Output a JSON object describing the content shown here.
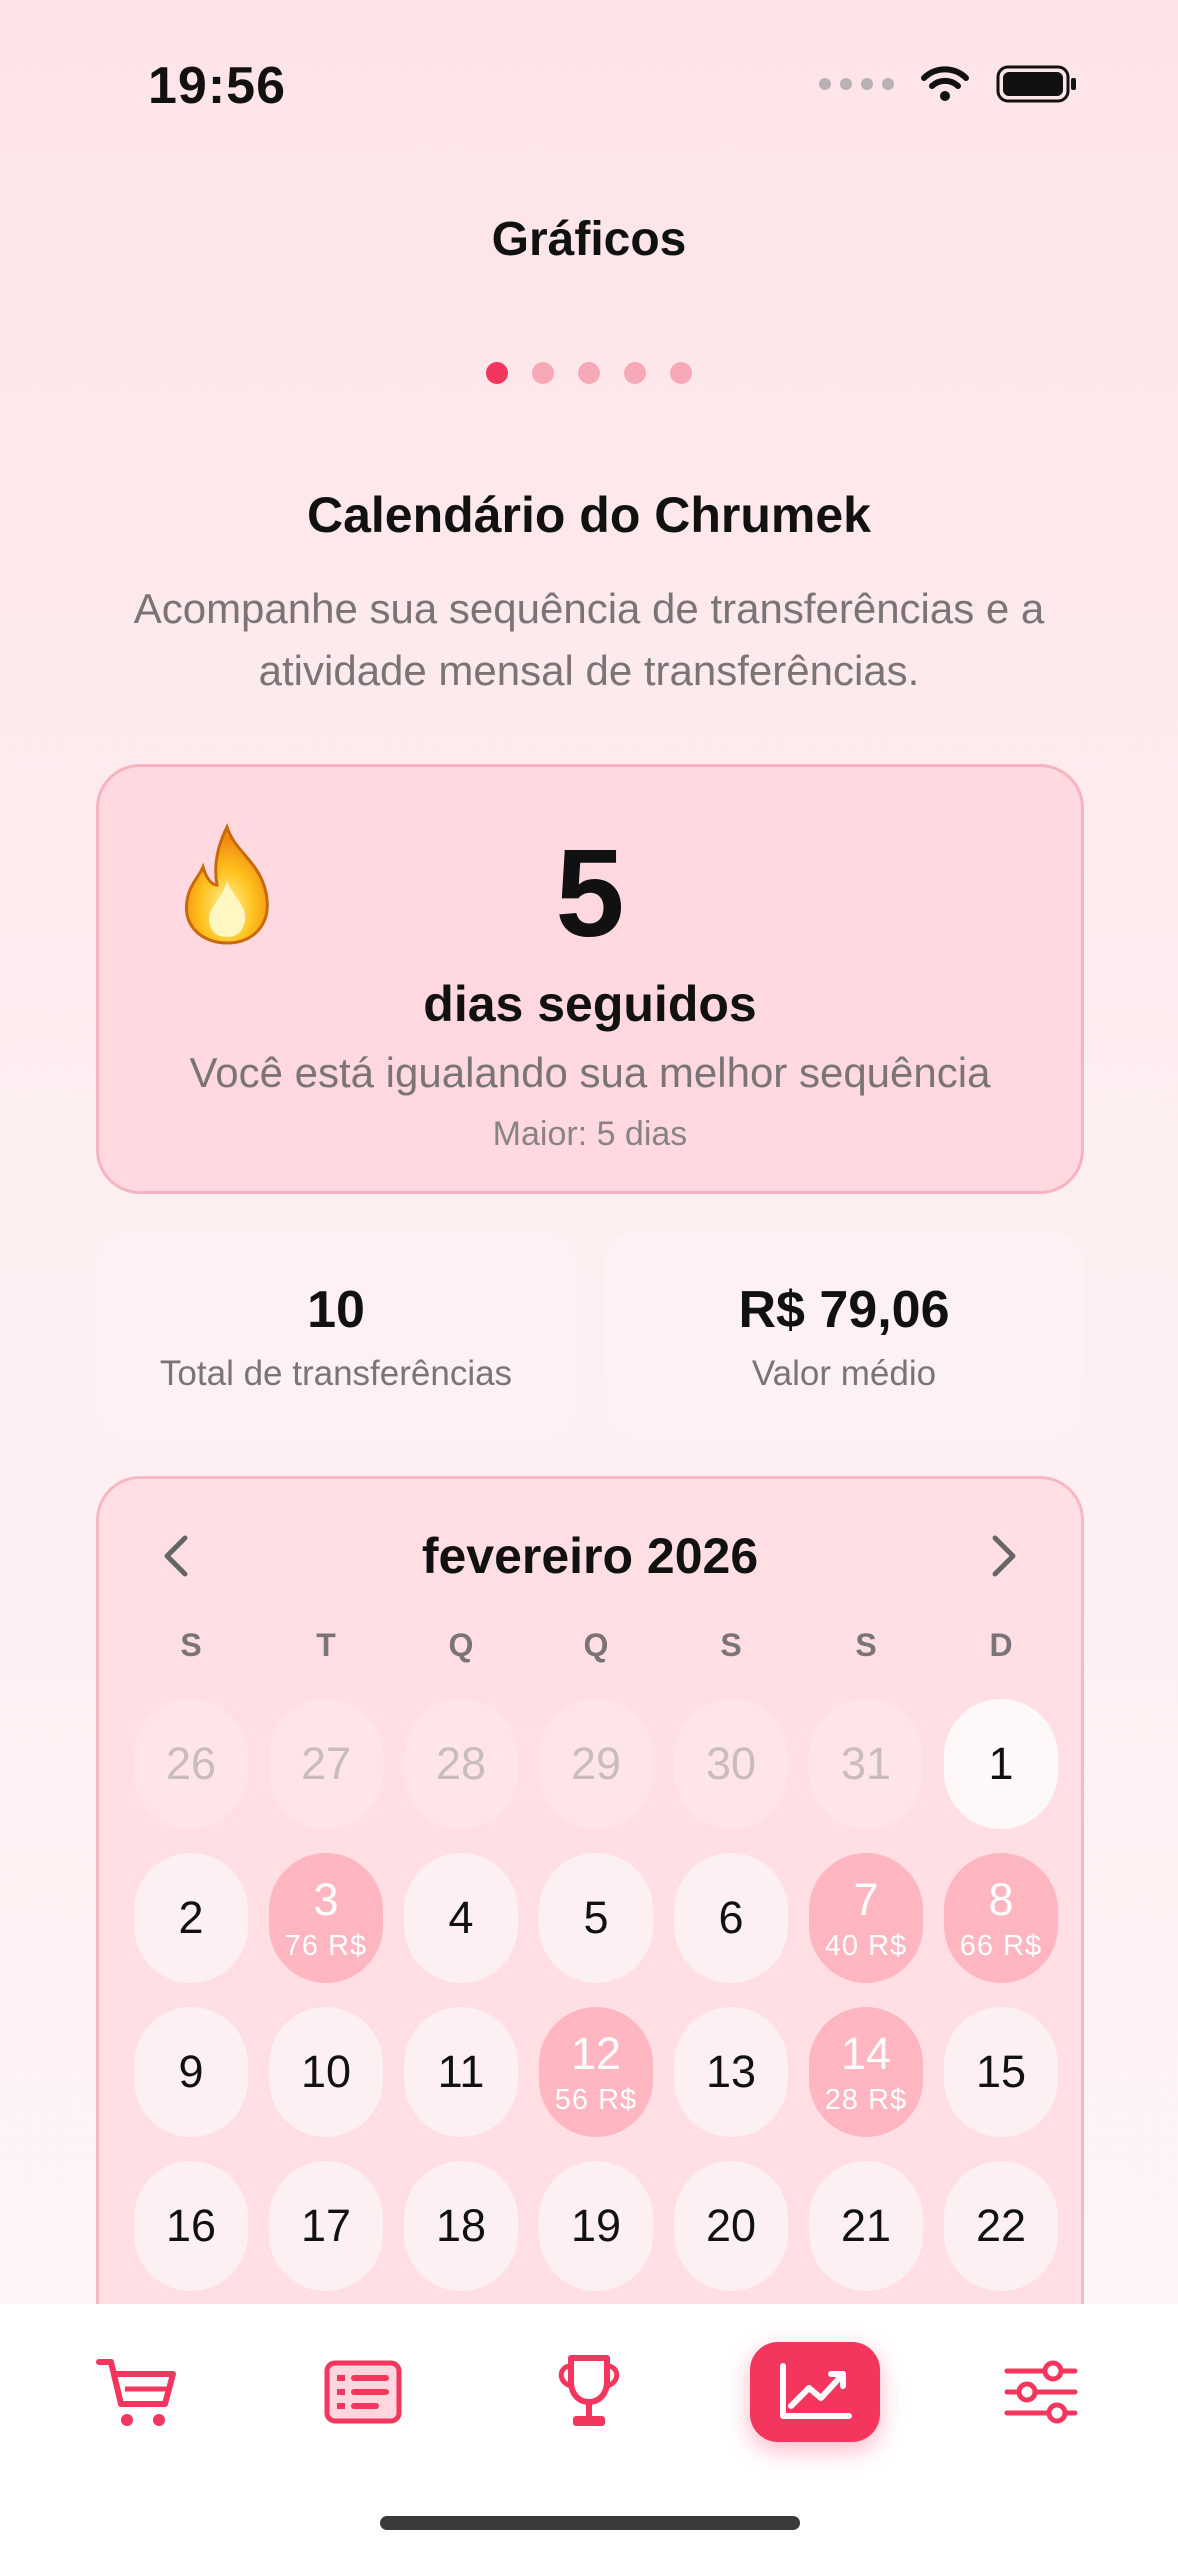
{
  "status_bar": {
    "time": "19:56"
  },
  "header": {
    "title": "Gráficos",
    "pager": {
      "count": 5,
      "active_index": 0
    }
  },
  "section": {
    "title": "Calendário do Chrumek",
    "subtitle": "Acompanhe sua sequência de transferências e a atividade mensal de transferências."
  },
  "streak": {
    "icon": "flame-icon",
    "value": "5",
    "label": "dias seguidos",
    "message": "Você está igualando sua melhor sequência",
    "best": "Maior: 5 dias"
  },
  "stats": {
    "total": {
      "value": "10",
      "label": "Total de transferências"
    },
    "average": {
      "value": "R$ 79,06",
      "label": "Valor médio"
    }
  },
  "calendar": {
    "month_label": "fevereiro 2026",
    "weekdays": [
      "S",
      "T",
      "Q",
      "Q",
      "S",
      "S",
      "D"
    ],
    "days": [
      {
        "day": "26",
        "state": "muted"
      },
      {
        "day": "27",
        "state": "muted"
      },
      {
        "day": "28",
        "state": "muted"
      },
      {
        "day": "29",
        "state": "muted"
      },
      {
        "day": "30",
        "state": "muted"
      },
      {
        "day": "31",
        "state": "muted"
      },
      {
        "day": "1",
        "state": "today"
      },
      {
        "day": "2",
        "state": "normal"
      },
      {
        "day": "3",
        "state": "hit",
        "amount": "76 R$"
      },
      {
        "day": "4",
        "state": "normal"
      },
      {
        "day": "5",
        "state": "normal"
      },
      {
        "day": "6",
        "state": "normal"
      },
      {
        "day": "7",
        "state": "hit",
        "amount": "40 R$"
      },
      {
        "day": "8",
        "state": "hit",
        "amount": "66 R$"
      },
      {
        "day": "9",
        "state": "normal"
      },
      {
        "day": "10",
        "state": "normal"
      },
      {
        "day": "11",
        "state": "normal"
      },
      {
        "day": "12",
        "state": "hit",
        "amount": "56 R$"
      },
      {
        "day": "13",
        "state": "normal"
      },
      {
        "day": "14",
        "state": "hit",
        "amount": "28 R$"
      },
      {
        "day": "15",
        "state": "normal"
      },
      {
        "day": "16",
        "state": "normal"
      },
      {
        "day": "17",
        "state": "normal"
      },
      {
        "day": "18",
        "state": "normal"
      },
      {
        "day": "19",
        "state": "normal"
      },
      {
        "day": "20",
        "state": "normal"
      },
      {
        "day": "21",
        "state": "normal"
      },
      {
        "day": "22",
        "state": "normal"
      }
    ]
  },
  "tab_bar": {
    "tabs": [
      {
        "icon": "cart-icon",
        "active": false
      },
      {
        "icon": "list-icon",
        "active": false
      },
      {
        "icon": "trophy-icon",
        "active": false
      },
      {
        "icon": "chart-icon",
        "active": true
      },
      {
        "icon": "sliders-icon",
        "active": false
      }
    ]
  },
  "colors": {
    "accent": "#f4355e",
    "highlight_day": "#ffb6c1",
    "card_pink": "#ffd9df",
    "background": "#fde4e8"
  }
}
